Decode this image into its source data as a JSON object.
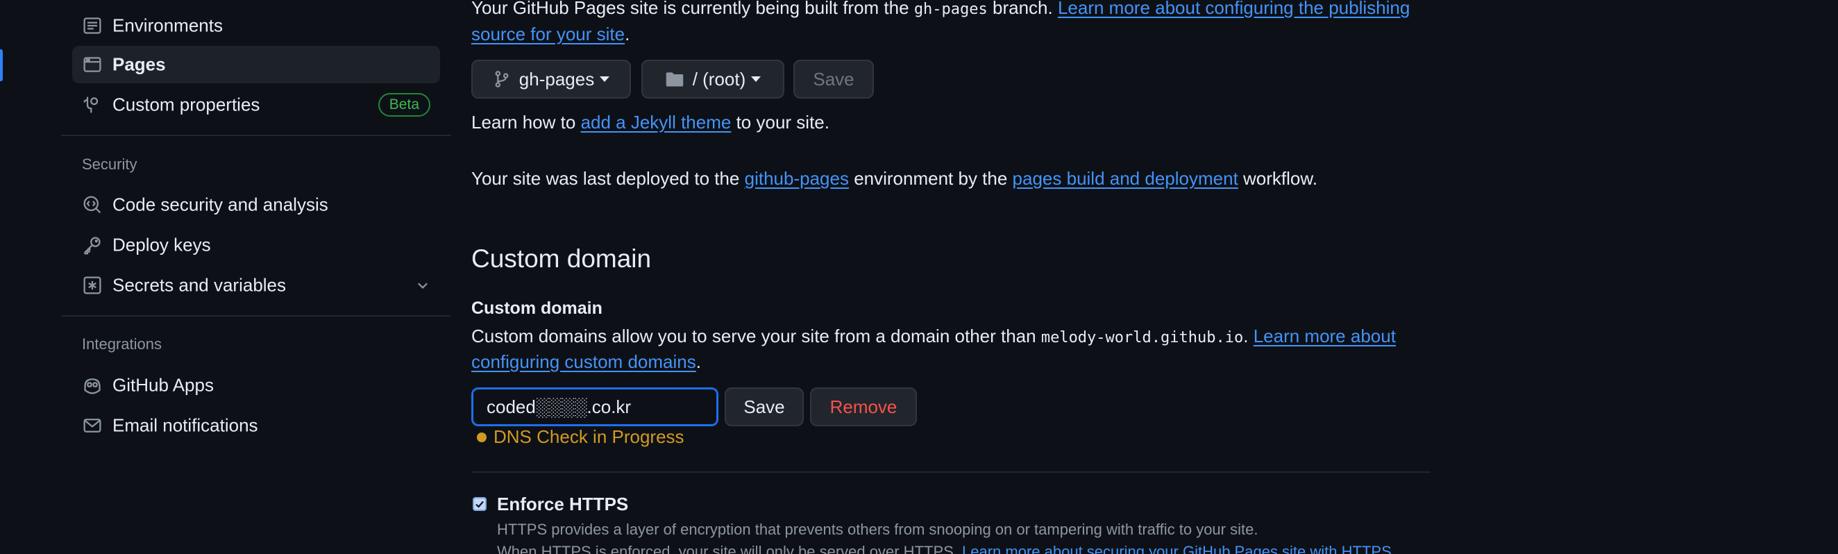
{
  "sidebar": {
    "items_top": [
      {
        "label": "Environments",
        "icon": "environments-icon"
      },
      {
        "label": "Pages",
        "icon": "browser-icon",
        "active": true
      },
      {
        "label": "Custom properties",
        "icon": "tag-icon",
        "badge": "Beta"
      }
    ],
    "security": {
      "title": "Security",
      "items": [
        {
          "label": "Code security and analysis",
          "icon": "codescan-icon"
        },
        {
          "label": "Deploy keys",
          "icon": "key-icon"
        },
        {
          "label": "Secrets and variables",
          "icon": "asterisk-icon"
        }
      ]
    },
    "integrations": {
      "title": "Integrations",
      "items": [
        {
          "label": "GitHub Apps",
          "icon": "copilot-icon"
        },
        {
          "label": "Email notifications",
          "icon": "mail-icon"
        }
      ]
    }
  },
  "source": {
    "line1_prefix": "Your GitHub Pages site is currently being built from the ",
    "line1_code": "gh-pages",
    "line1_mid": " branch. ",
    "line1_link": "Learn more about configuring the publishing",
    "line2_link": "source for your site",
    "line2_suffix": ".",
    "branch_button": "gh-pages",
    "folder_button": "/ (root)",
    "save_button": "Save",
    "jekyll_prefix": "Learn how to ",
    "jekyll_link": "add a Jekyll theme",
    "jekyll_suffix": " to your site.",
    "deploy_prefix": "Your site was last deployed to the ",
    "deploy_link1": "github-pages",
    "deploy_mid": " environment by the ",
    "deploy_link2": "pages build and deployment",
    "deploy_suffix": " workflow."
  },
  "custom_domain": {
    "heading": "Custom domain",
    "label": "Custom domain",
    "desc_prefix": "Custom domains allow you to serve your site from a domain other than ",
    "desc_code": "melody-world.github.io",
    "desc_mid": ". ",
    "desc_link1": "Learn more about",
    "desc_link2": "configuring custom domains",
    "desc_suffix": ".",
    "input_value": "coded░░░░.co.kr",
    "save_button": "Save",
    "remove_button": "Remove",
    "status": "DNS Check in Progress",
    "status_color": "#d29922"
  },
  "https": {
    "label": "Enforce HTTPS",
    "checked": true,
    "desc1": "HTTPS provides a layer of encryption that prevents others from snooping on or tampering with traffic to your site.",
    "desc2_prefix": "When HTTPS is enforced, your site will only be served over HTTPS. ",
    "desc2_link": "Learn more about securing your GitHub Pages site with HTTPS"
  },
  "colors": {
    "accent": "#2f81f7",
    "link": "#4493f8",
    "danger": "#f85149",
    "badge": "#3fb950"
  }
}
